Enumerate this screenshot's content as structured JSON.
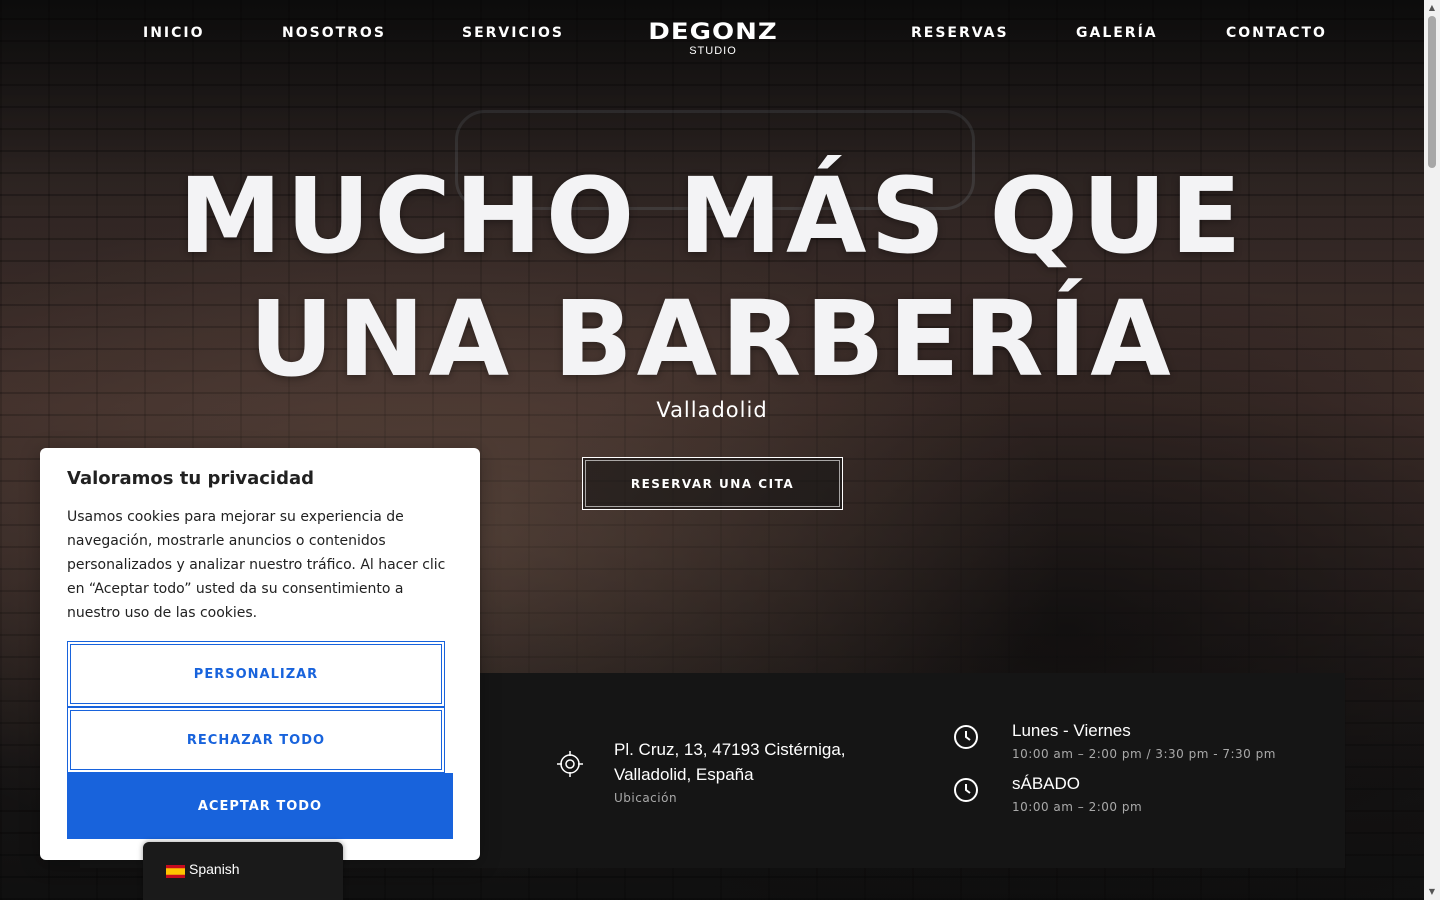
{
  "nav": {
    "items_left": [
      "INICIO",
      "NOSOTROS",
      "SERVICIOS"
    ],
    "items_right": [
      "RESERVAS",
      "GALERÍA",
      "CONTACTO"
    ],
    "logo_main": "DEGONZ",
    "logo_sub": "STUDIO"
  },
  "hero": {
    "headline_line1": "MUCHO MÁS QUE",
    "headline_line2": "UNA BARBERÍA",
    "subtitle": "Valladolid",
    "cta_label": "RESERVAR UNA CITA"
  },
  "info": {
    "location": {
      "icon": "crosshair-icon",
      "line1": "Pl. Cruz, 13, 47193 Cistérniga,",
      "line2": "Valladolid, España",
      "sub": "Ubicación"
    },
    "hours": [
      {
        "icon": "clock-icon",
        "title": "Lunes - Viernes",
        "time": "10:00 am – 2:00 pm / 3:30 pm - 7:30 pm"
      },
      {
        "icon": "clock-icon",
        "title": "sÁBADO",
        "time": "10:00 am – 2:00 pm"
      }
    ]
  },
  "cookie": {
    "title": "Valoramos tu privacidad",
    "text": "Usamos cookies para mejorar su experiencia de navegación, mostrarle anuncios o contenidos personalizados y analizar nuestro tráfico. Al hacer clic en “Aceptar todo” usted da su consentimiento a nuestro uso de las cookies.",
    "customize_label": "PERSONALIZAR",
    "reject_label": "RECHAZAR TODO",
    "accept_label": "ACEPTAR TODO"
  },
  "language": {
    "label": "Spanish",
    "flag": "spain-flag-icon"
  },
  "colors": {
    "cookie_primary": "#1863dc",
    "info_band": "#151515"
  }
}
